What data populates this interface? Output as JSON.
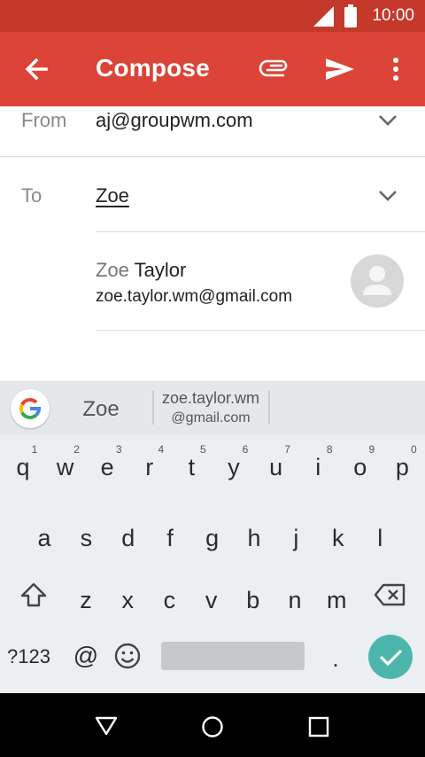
{
  "status_bar": {
    "time": "10:00",
    "icons": [
      "signal-icon",
      "battery-icon"
    ]
  },
  "app_bar": {
    "title": "Compose",
    "back_icon": "arrow-back-icon",
    "attach_icon": "paperclip-icon",
    "send_icon": "send-icon",
    "more_icon": "more-vert-icon",
    "color": "#db4437",
    "status_color": "#c5392b"
  },
  "compose": {
    "from_label": "From",
    "from_value": "aj@groupwm.com",
    "to_label": "To",
    "to_value": "Zoe"
  },
  "contact_suggestion": {
    "first": "Zoe",
    "last": "Taylor",
    "email": "zoe.taylor.wm@gmail.com",
    "avatar": "person-icon"
  },
  "suggestion_strip": {
    "logo": "google-g-icon",
    "word": "Zoe",
    "email_line1": "zoe.taylor.wm",
    "email_line2": "@gmail.com"
  },
  "keyboard": {
    "row1": [
      {
        "char": "q",
        "hint": "1"
      },
      {
        "char": "w",
        "hint": "2"
      },
      {
        "char": "e",
        "hint": "3"
      },
      {
        "char": "r",
        "hint": "4"
      },
      {
        "char": "t",
        "hint": "5"
      },
      {
        "char": "y",
        "hint": "6"
      },
      {
        "char": "u",
        "hint": "7"
      },
      {
        "char": "i",
        "hint": "8"
      },
      {
        "char": "o",
        "hint": "9"
      },
      {
        "char": "p",
        "hint": "0"
      }
    ],
    "row2": [
      "a",
      "s",
      "d",
      "f",
      "g",
      "h",
      "j",
      "k",
      "l"
    ],
    "row3": [
      "z",
      "x",
      "c",
      "v",
      "b",
      "n",
      "m"
    ],
    "sym_label": "?123",
    "at_label": "@",
    "period_label": ".",
    "shift_icon": "shift-icon",
    "backspace_icon": "backspace-icon",
    "emoji_icon": "emoji-icon",
    "enter_icon": "checkmark-icon",
    "accent": "#4db6ac"
  },
  "nav_bar": {
    "icons": [
      "nav-back-icon",
      "nav-home-icon",
      "nav-recents-icon"
    ]
  }
}
